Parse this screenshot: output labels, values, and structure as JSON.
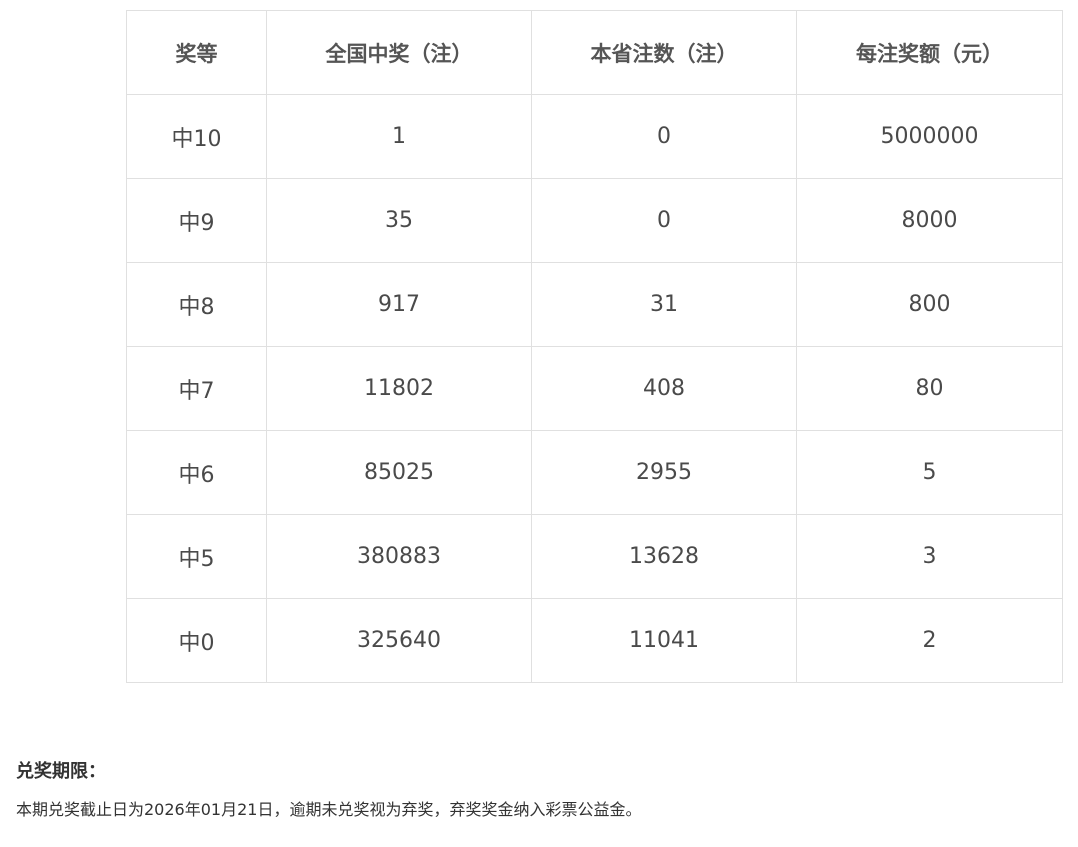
{
  "table": {
    "headers": {
      "level": "奖等",
      "national": "全国中奖（注）",
      "province": "本省注数（注）",
      "amount": "每注奖额（元）"
    },
    "rows": [
      {
        "level": "中10",
        "national": "1",
        "province": "0",
        "amount": "5000000"
      },
      {
        "level": "中9",
        "national": "35",
        "province": "0",
        "amount": "8000"
      },
      {
        "level": "中8",
        "national": "917",
        "province": "31",
        "amount": "800"
      },
      {
        "level": "中7",
        "national": "11802",
        "province": "408",
        "amount": "80"
      },
      {
        "level": "中6",
        "national": "85025",
        "province": "2955",
        "amount": "5"
      },
      {
        "level": "中5",
        "national": "380883",
        "province": "13628",
        "amount": "3"
      },
      {
        "level": "中0",
        "national": "325640",
        "province": "11041",
        "amount": "2"
      }
    ]
  },
  "deadline": {
    "title": "兑奖期限：",
    "text": "本期兑奖截止日为2026年01月21日，逾期未兑奖视为弃奖，弃奖奖金纳入彩票公益金。"
  }
}
